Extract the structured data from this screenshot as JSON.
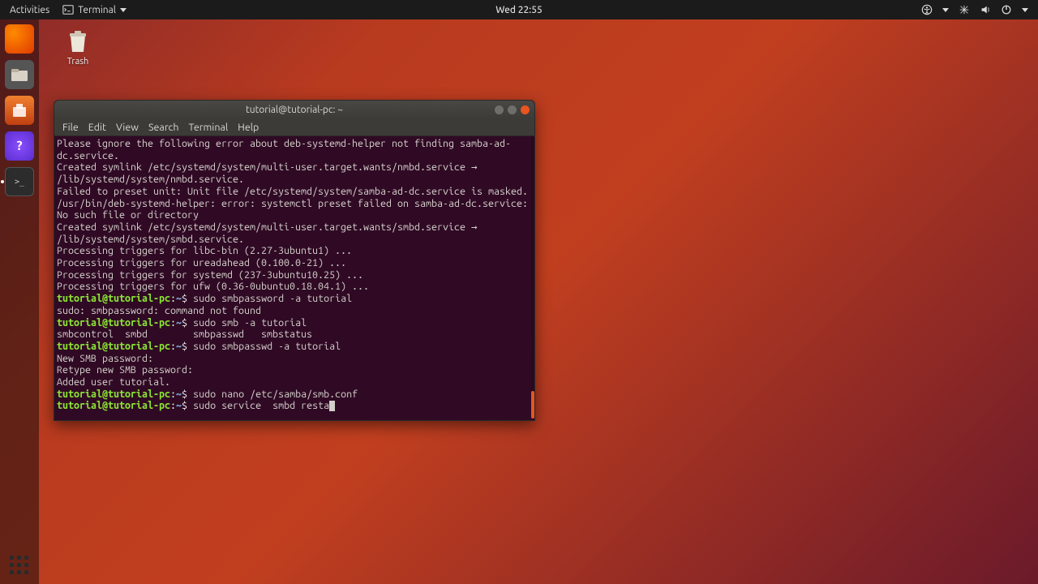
{
  "panel": {
    "activities": "Activities",
    "app": "Terminal",
    "clock": "Wed 22:55"
  },
  "desktop": {
    "trash": "Trash"
  },
  "window": {
    "title": "tutorial@tutorial-pc: ~",
    "menu": [
      "File",
      "Edit",
      "View",
      "Search",
      "Terminal",
      "Help"
    ]
  },
  "term": {
    "out1": "Please ignore the following error about deb-systemd-helper not finding samba-ad-dc.service.",
    "out2": "Created symlink /etc/systemd/system/multi-user.target.wants/nmbd.service → /lib/systemd/system/nmbd.service.",
    "out3": "Failed to preset unit: Unit file /etc/systemd/system/samba-ad-dc.service is masked.",
    "out4": "/usr/bin/deb-systemd-helper: error: systemctl preset failed on samba-ad-dc.service: No such file or directory",
    "out5": "Created symlink /etc/systemd/system/multi-user.target.wants/smbd.service → /lib/systemd/system/smbd.service.",
    "out6": "Processing triggers for libc-bin (2.27-3ubuntu1) ...",
    "out7": "Processing triggers for ureadahead (0.100.0-21) ...",
    "out8": "Processing triggers for systemd (237-3ubuntu10.25) ...",
    "out9": "Processing triggers for ufw (0.36-0ubuntu0.18.04.1) ...",
    "user": "tutorial@tutorial-pc",
    "path": "~",
    "sep1": ":",
    "sep2": "$ ",
    "cmd1": "sudo smbpassword -a tutorial",
    "err1": "sudo: smbpassword: command not found",
    "cmd2": "sudo smb -a tutorial",
    "comp": "smbcontrol  smbd        smbpasswd   smbstatus",
    "cmd3": "sudo smbpasswd -a tutorial",
    "out10": "New SMB password:",
    "out11": "Retype new SMB password:",
    "out12": "Added user tutorial.",
    "cmd4": "sudo nano /etc/samba/smb.conf",
    "cmd5": "sudo service  smbd resta"
  }
}
